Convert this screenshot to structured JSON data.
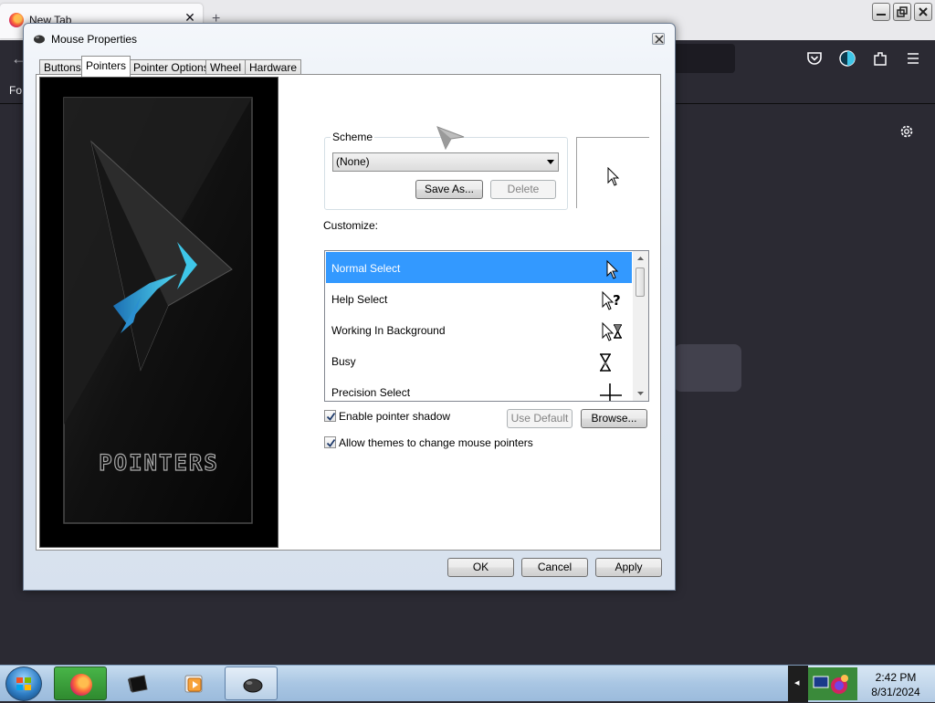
{
  "browser": {
    "tab_title": "New Tab",
    "bookmarks_text": "Fo"
  },
  "dialog": {
    "title": "Mouse Properties",
    "tabs": [
      {
        "label": "Buttons"
      },
      {
        "label": "Pointers"
      },
      {
        "label": "Pointer Options"
      },
      {
        "label": "Wheel"
      },
      {
        "label": "Hardware"
      }
    ],
    "active_tab": "Pointers",
    "preview_image_text": "POINTERS",
    "scheme": {
      "label": "Scheme",
      "selected": "(None)",
      "save_as": "Save As...",
      "delete": "Delete"
    },
    "customize_label": "Customize:",
    "cursor_list": [
      {
        "label": "Normal Select",
        "icon": "arrow-cursor-icon",
        "selected": true
      },
      {
        "label": "Help Select",
        "icon": "help-cursor-icon",
        "selected": false
      },
      {
        "label": "Working In Background",
        "icon": "working-cursor-icon",
        "selected": false
      },
      {
        "label": "Busy",
        "icon": "hourglass-cursor-icon",
        "selected": false
      },
      {
        "label": "Precision Select",
        "icon": "crosshair-cursor-icon",
        "selected": false
      }
    ],
    "enable_shadow": {
      "label": "Enable pointer shadow",
      "checked": true
    },
    "use_default": "Use Default",
    "browse": "Browse...",
    "allow_themes": {
      "label": "Allow themes to change mouse pointers",
      "checked": true
    },
    "ok": "OK",
    "cancel": "Cancel",
    "apply": "Apply"
  },
  "taskbar": {
    "items": [
      "firefox-icon",
      "terminal-icon",
      "media-player-icon",
      "mouse-icon"
    ],
    "clock_time": "2:42 PM",
    "clock_date": "8/31/2024"
  },
  "colors": {
    "selection": "#3399ff",
    "accent_cyan": "#3ec6e8"
  }
}
